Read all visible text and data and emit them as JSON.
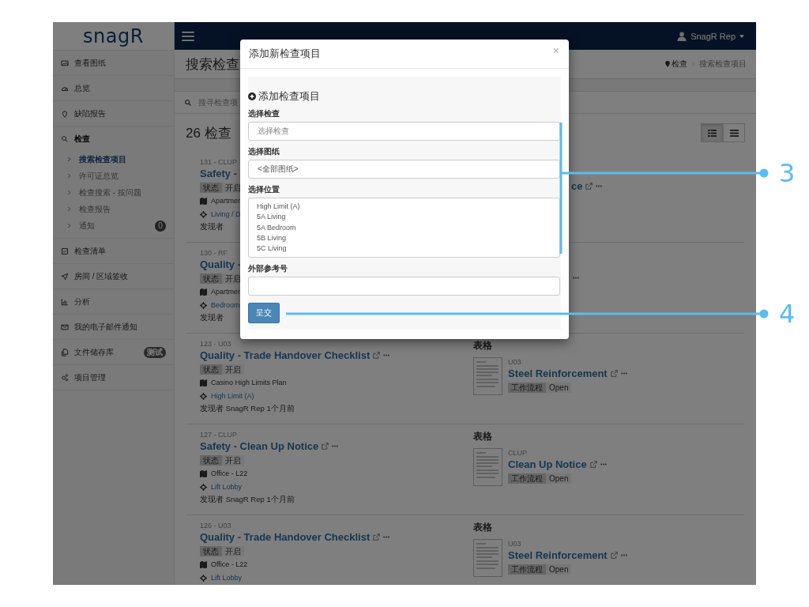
{
  "sidebar": {
    "logo": "snagR",
    "items": [
      {
        "label": "查看图纸"
      },
      {
        "label": "总览"
      },
      {
        "label": "缺陷报告"
      },
      {
        "label": "检查",
        "expanded": true,
        "children": [
          {
            "label": "搜索检查项目",
            "selected": true
          },
          {
            "label": "许可证总览",
            "selected": false
          },
          {
            "label": "检查搜索 - 按问题",
            "selected": false
          },
          {
            "label": "检查报告",
            "selected": false
          },
          {
            "label": "通知",
            "selected": false,
            "badge": "0"
          }
        ]
      },
      {
        "label": "检查清单"
      },
      {
        "label": "房间 / 区域签收"
      },
      {
        "label": "分析"
      },
      {
        "label": "我的电子邮件通知"
      },
      {
        "label": "文件储存库",
        "badge": "测试"
      },
      {
        "label": "项目管理"
      }
    ]
  },
  "header": {
    "user": "SnagR Rep"
  },
  "page": {
    "title": "搜索检查",
    "breadcrumb": [
      "检查",
      "搜索检查项目"
    ],
    "search_placeholder": "搜寻检查项",
    "count": "26 检查",
    "view_buttons": [
      {
        "selected": true
      },
      {
        "selected": false
      }
    ]
  },
  "inspections": [
    {
      "code": "131 - CLUP",
      "title": "Safety -",
      "link_icons": false,
      "status_label": "状态",
      "status": "开启",
      "plan": "Apartmen",
      "location": "Living / D",
      "found": "发现者",
      "form": {
        "kind": "tail",
        "title": "ce"
      }
    },
    {
      "code": "130 - RF",
      "title": "Quality -",
      "link_icons": false,
      "status_label": "状态",
      "status": "开启",
      "plan": "Apartmen",
      "location": "Bedroom",
      "found": "发现者",
      "form": {
        "kind": "dots"
      }
    },
    {
      "code": "123 - U03",
      "title": "Quality - Trade Handover Checklist",
      "link_icons": true,
      "status_label": "状态",
      "status": "开启",
      "plan": "Casino High Limits Plan",
      "location": "High Limit (A)",
      "found": "发现者 SnagR Rep 1个月前",
      "form": {
        "kind": "full",
        "heading": "表格",
        "code": "U03",
        "title": "Steel Reinforcement",
        "tag_label": "工作流程",
        "tag": "Open"
      }
    },
    {
      "code": "127 - CLUP",
      "title": "Safety - Clean Up Notice",
      "link_icons": true,
      "status_label": "状态",
      "status": "开启",
      "plan": "Office - L22",
      "location": "Lift Lobby",
      "found": "发现者 SnagR Rep 1个月前",
      "form": {
        "kind": "full",
        "heading": "表格",
        "code": "CLUP",
        "title": "Clean Up Notice",
        "tag_label": "工作流程",
        "tag": "Open"
      }
    },
    {
      "code": "126 - U03",
      "title": "Quality - Trade Handover Checklist",
      "link_icons": true,
      "status_label": "状态",
      "status": "开启",
      "plan": "Office - L22",
      "location": "Lift Lobby",
      "form": {
        "kind": "full",
        "heading": "表格",
        "code": "U03",
        "title": "Steel Reinforcement",
        "tag_label": "工作流程",
        "tag": "Open"
      }
    }
  ],
  "modal": {
    "title": "添加新检查项目",
    "close": "×",
    "heading": "添加检查项目",
    "fields": [
      {
        "kind": "select",
        "label": "选择检查",
        "placeholder": "选择检查"
      },
      {
        "kind": "select",
        "label": "选择图纸",
        "value": "<全部图纸>"
      },
      {
        "kind": "listbox",
        "label": "选择位置",
        "options": [
          "High Limit (A)",
          "5A Living",
          "5A Bedroom",
          "5B Living",
          "5C Living"
        ]
      },
      {
        "kind": "text",
        "label": "外部参考号"
      }
    ],
    "submit": "呈交"
  },
  "annotations": [
    {
      "label": "3"
    },
    {
      "label": "4"
    }
  ]
}
